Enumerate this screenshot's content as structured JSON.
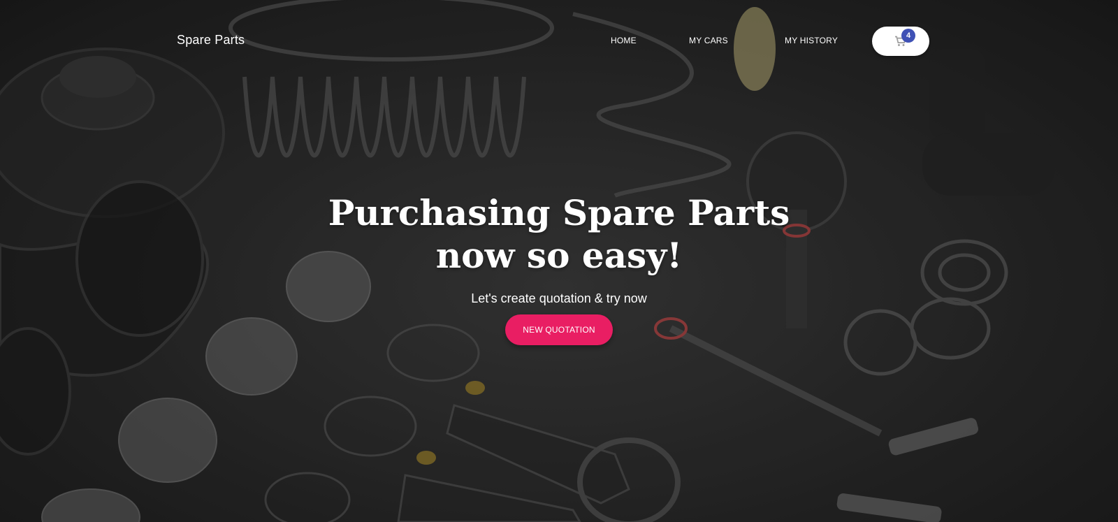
{
  "brand": {
    "name": "Spare Parts"
  },
  "nav": {
    "items": [
      {
        "label": "HOME"
      },
      {
        "label": "MY CARS"
      },
      {
        "label": "MY HISTORY"
      }
    ],
    "cart": {
      "icon": "shopping-cart-icon",
      "count": "4"
    }
  },
  "hero": {
    "title_line_1": "Purchasing Spare Parts",
    "title_line_2": "now so easy!",
    "subtitle": "Let's create quotation & try now",
    "cta_label": "NEW QUOTATION"
  },
  "colors": {
    "accent": "#e91e63",
    "badge": "#3f51b5",
    "text_on_dark": "#ffffff"
  }
}
